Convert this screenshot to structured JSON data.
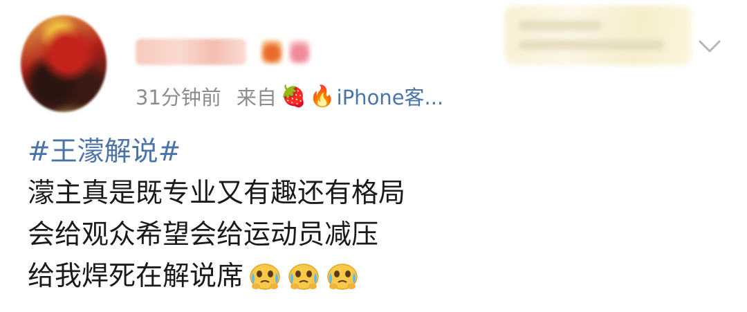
{
  "post": {
    "time": "31分钟前",
    "source_prefix": "来自",
    "source_emojis": [
      "🍓",
      "🔥"
    ],
    "source_client": "iPhone客...",
    "hashtag": "#王濛解说#",
    "lines": [
      "濛主真是既专业又有趣还有格局",
      "会给观众希望会给运动员减压",
      "给我焊死在解说席"
    ],
    "reaction_emoji_count": 3
  },
  "icons": {
    "more": "chevron-down-icon",
    "reaction": "crying-face-emoji-icon"
  },
  "colors": {
    "link": "#4a73a8",
    "meta": "#8c8c8c",
    "text": "#1a1a1a"
  }
}
